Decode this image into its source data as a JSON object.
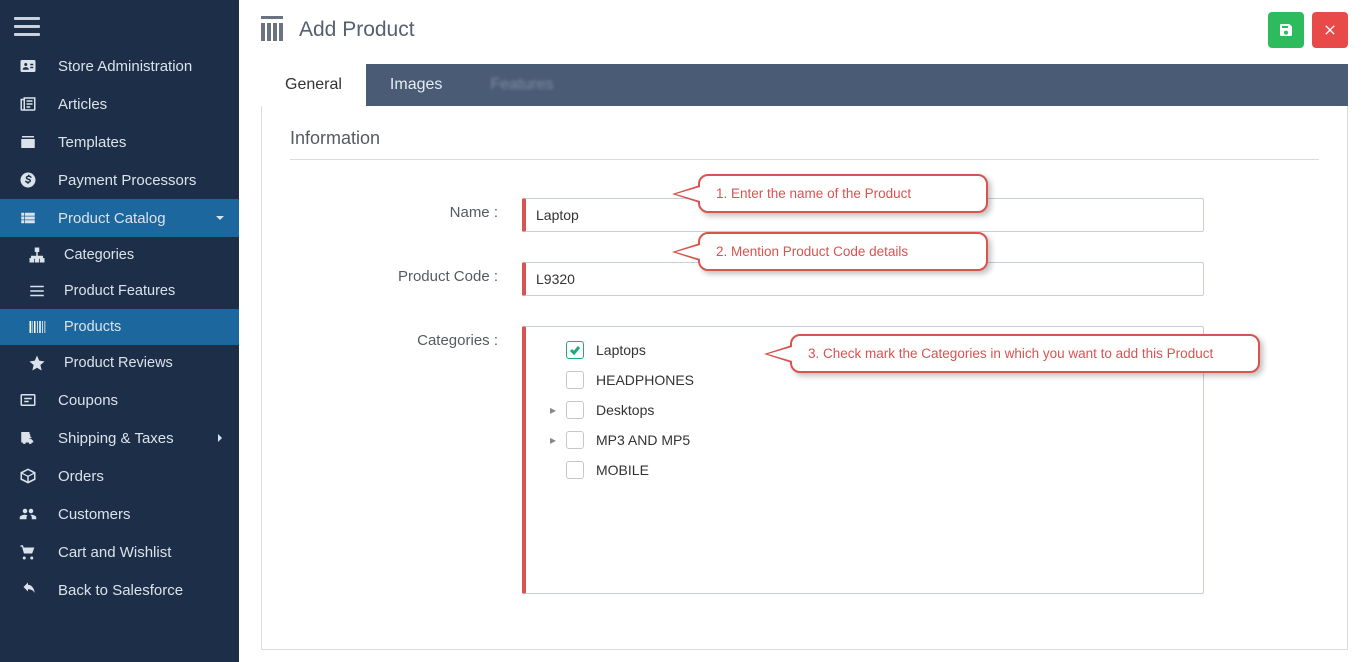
{
  "sidebar": {
    "items": [
      {
        "icon": "id-card",
        "label": "Store Administration"
      },
      {
        "icon": "newspaper",
        "label": "Articles"
      },
      {
        "icon": "archive",
        "label": "Templates"
      },
      {
        "icon": "money",
        "label": "Payment Processors"
      },
      {
        "icon": "catalog",
        "label": "Product Catalog",
        "caret": "down",
        "active": true
      },
      {
        "icon": "sitemap",
        "label": "Categories",
        "sub": true
      },
      {
        "icon": "list-lines",
        "label": "Product Features",
        "sub": true
      },
      {
        "icon": "barcode",
        "label": "Products",
        "sub": true,
        "selected": true
      },
      {
        "icon": "star",
        "label": "Product Reviews",
        "sub": true
      },
      {
        "icon": "ticket",
        "label": "Coupons"
      },
      {
        "icon": "truck",
        "label": "Shipping & Taxes",
        "caret": "right"
      },
      {
        "icon": "box",
        "label": "Orders"
      },
      {
        "icon": "users",
        "label": "Customers"
      },
      {
        "icon": "cart",
        "label": "Cart and Wishlist"
      },
      {
        "icon": "back-arrow",
        "label": "Back to Salesforce"
      }
    ]
  },
  "header": {
    "title": "Add Product"
  },
  "tabs": [
    {
      "id": "general",
      "label": "General",
      "active": true
    },
    {
      "id": "images",
      "label": "Images"
    },
    {
      "id": "features",
      "label": "Features",
      "blurred": true
    }
  ],
  "form": {
    "section_title": "Information",
    "name_label": "Name :",
    "name_value": "Laptop",
    "code_label": "Product Code :",
    "code_value": "L9320",
    "categories_label": "Categories :",
    "categories": [
      {
        "label": "Laptops",
        "checked": true,
        "expandable": false
      },
      {
        "label": "HEADPHONES",
        "checked": false,
        "expandable": false
      },
      {
        "label": "Desktops",
        "checked": false,
        "expandable": true
      },
      {
        "label": "MP3 AND MP5",
        "checked": false,
        "expandable": true
      },
      {
        "label": "MOBILE",
        "checked": false,
        "expandable": false
      }
    ]
  },
  "callouts": {
    "c1": "1. Enter the name of the Product",
    "c2": "2. Mention Product Code details",
    "c3": "3.  Check mark the Categories in which you want to add this Product"
  }
}
